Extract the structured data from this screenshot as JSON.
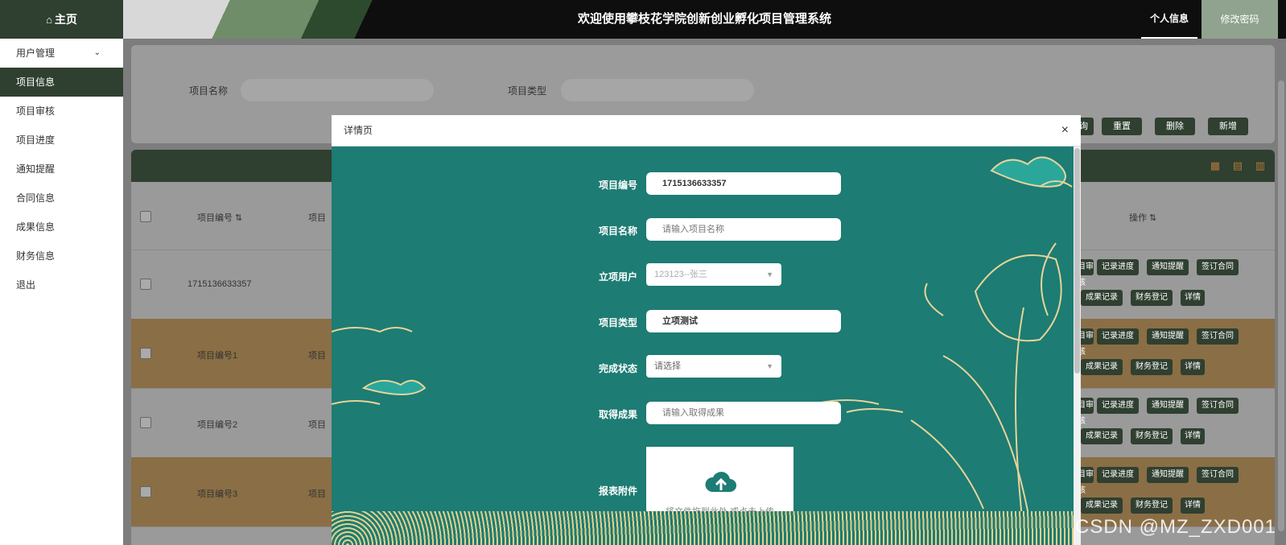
{
  "sidebar": {
    "home_label": "主页",
    "items": [
      {
        "label": "用户管理",
        "has_submenu": true
      },
      {
        "label": "项目信息",
        "active": true
      },
      {
        "label": "项目审核"
      },
      {
        "label": "项目进度"
      },
      {
        "label": "通知提醒"
      },
      {
        "label": "合同信息"
      },
      {
        "label": "成果信息"
      },
      {
        "label": "财务信息"
      },
      {
        "label": "退出"
      }
    ]
  },
  "header": {
    "title": "欢迎使用攀枝花学院创新创业孵化项目管理系统",
    "personal_info": "个人信息",
    "change_password": "修改密码"
  },
  "search": {
    "project_name_label": "项目名称",
    "project_type_label": "项目类型",
    "buttons": {
      "query": "查询",
      "reset": "重置",
      "delete": "删除",
      "add": "新增"
    }
  },
  "table": {
    "columns": [
      "项目编号",
      "项目",
      "操作"
    ],
    "rows": [
      {
        "id": "1715136633357",
        "name": ""
      },
      {
        "id": "项目编号1",
        "name": "项目"
      },
      {
        "id": "项目编号2",
        "name": "项目"
      },
      {
        "id": "项目编号3",
        "name": "项目"
      }
    ],
    "row_actions": {
      "audit": "项目审核",
      "progress": "记录进度",
      "notify": "通知提醒",
      "contract": "签订合同",
      "result": "成果记录",
      "finance": "财务登记",
      "detail": "详情"
    }
  },
  "modal": {
    "title": "详情页",
    "close": "×",
    "fields": {
      "project_no": {
        "label": "项目编号",
        "value": "1715136633357"
      },
      "project_name": {
        "label": "项目名称",
        "placeholder": "请输入项目名称"
      },
      "project_user": {
        "label": "立项用户",
        "value": "123123--张三"
      },
      "project_type": {
        "label": "项目类型",
        "value": "立项测试"
      },
      "status": {
        "label": "完成状态",
        "placeholder": "请选择"
      },
      "achievement": {
        "label": "取得成果",
        "placeholder": "请输入取得成果"
      },
      "attachment": {
        "label": "报表附件",
        "upload_text": "将文件拖到此处,或点击上传"
      }
    }
  },
  "watermark": "CSDN @MZ_ZXD001",
  "colors": {
    "primary": "#2f3f30",
    "modal_bg": "#1d7c73",
    "row_highlight": "#8a6e45"
  }
}
